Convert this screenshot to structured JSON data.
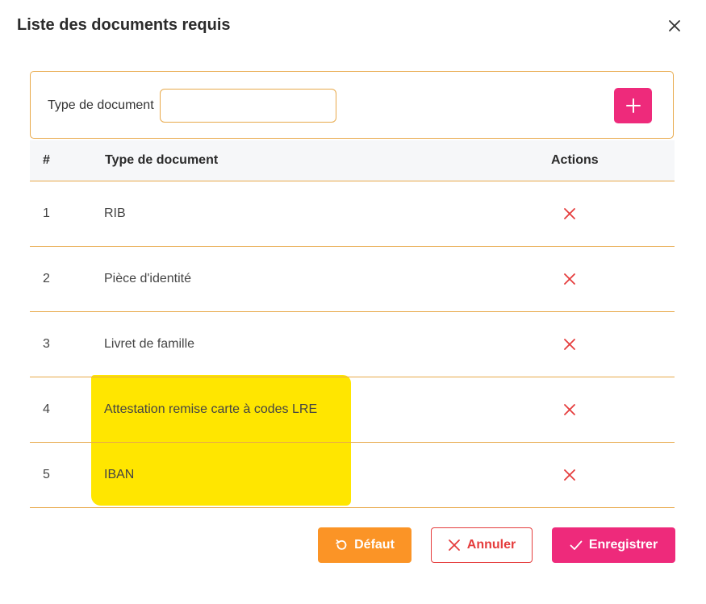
{
  "dialog": {
    "title": "Liste des documents requis",
    "close_icon": "close-icon"
  },
  "add_form": {
    "label": "Type de document",
    "input_value": "",
    "input_placeholder": "",
    "add_icon": "plus-icon"
  },
  "table": {
    "headers": [
      "#",
      "Type de document",
      "Actions"
    ],
    "rows": [
      {
        "num": "1",
        "type": "RIB"
      },
      {
        "num": "2",
        "type": "Pièce d'identité"
      },
      {
        "num": "3",
        "type": "Livret de famille"
      },
      {
        "num": "4",
        "type": "Attestation remise carte à codes LRE"
      },
      {
        "num": "5",
        "type": "IBAN"
      }
    ],
    "delete_icon": "delete-x-icon"
  },
  "footer": {
    "default_label": "Défaut",
    "cancel_label": "Annuler",
    "save_label": "Enregistrer"
  },
  "colors": {
    "accent_pink": "#ee2a7b",
    "accent_orange": "#fb9426",
    "danger_red": "#e53d3d",
    "border_orange": "#e8a94a",
    "highlight_yellow": "#ffe600"
  }
}
